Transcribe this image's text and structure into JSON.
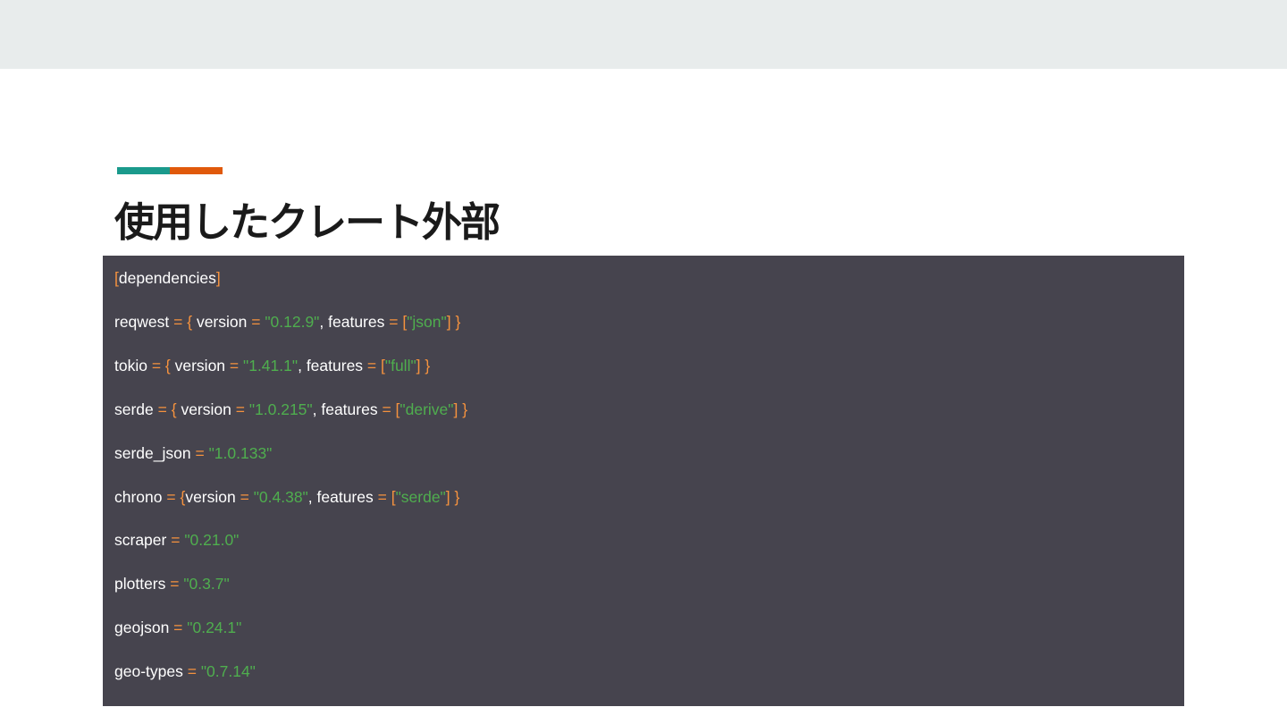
{
  "slide": {
    "title": "使用したクレート外部",
    "accent_colors": [
      "#1a9a8c",
      "#e0590b"
    ]
  },
  "code": {
    "colors": {
      "background": "#46444e",
      "key": "#ffffff",
      "punctuation": "#f5923e",
      "string": "#4fae4e"
    },
    "lines": [
      [
        {
          "t": "[",
          "k": "p"
        },
        {
          "t": "dependencies",
          "k": "k"
        },
        {
          "t": "]",
          "k": "p"
        }
      ],
      [
        {
          "t": "reqwest ",
          "k": "k"
        },
        {
          "t": "= { ",
          "k": "p"
        },
        {
          "t": "version ",
          "k": "k"
        },
        {
          "t": "= ",
          "k": "p"
        },
        {
          "t": "\"0.12.9\"",
          "k": "s"
        },
        {
          "t": ", features ",
          "k": "k"
        },
        {
          "t": "= [",
          "k": "p"
        },
        {
          "t": "\"json\"",
          "k": "s"
        },
        {
          "t": "] }",
          "k": "p"
        }
      ],
      [
        {
          "t": "tokio ",
          "k": "k"
        },
        {
          "t": "= { ",
          "k": "p"
        },
        {
          "t": "version ",
          "k": "k"
        },
        {
          "t": "= ",
          "k": "p"
        },
        {
          "t": "\"1.41.1\"",
          "k": "s"
        },
        {
          "t": ", features ",
          "k": "k"
        },
        {
          "t": "= [",
          "k": "p"
        },
        {
          "t": "\"full\"",
          "k": "s"
        },
        {
          "t": "] }",
          "k": "p"
        }
      ],
      [
        {
          "t": "serde ",
          "k": "k"
        },
        {
          "t": "= { ",
          "k": "p"
        },
        {
          "t": "version ",
          "k": "k"
        },
        {
          "t": "= ",
          "k": "p"
        },
        {
          "t": "\"1.0.215\"",
          "k": "s"
        },
        {
          "t": ", features ",
          "k": "k"
        },
        {
          "t": "= [",
          "k": "p"
        },
        {
          "t": "\"derive\"",
          "k": "s"
        },
        {
          "t": "] }",
          "k": "p"
        }
      ],
      [
        {
          "t": "serde_json ",
          "k": "k"
        },
        {
          "t": "= ",
          "k": "p"
        },
        {
          "t": "\"1.0.133\"",
          "k": "s"
        }
      ],
      [
        {
          "t": "chrono ",
          "k": "k"
        },
        {
          "t": "= {",
          "k": "p"
        },
        {
          "t": "version ",
          "k": "k"
        },
        {
          "t": "= ",
          "k": "p"
        },
        {
          "t": "\"0.4.38\"",
          "k": "s"
        },
        {
          "t": ", features ",
          "k": "k"
        },
        {
          "t": "= [",
          "k": "p"
        },
        {
          "t": "\"serde\"",
          "k": "s"
        },
        {
          "t": "] }",
          "k": "p"
        }
      ],
      [
        {
          "t": "scraper ",
          "k": "k"
        },
        {
          "t": "= ",
          "k": "p"
        },
        {
          "t": "\"0.21.0\"",
          "k": "s"
        }
      ],
      [
        {
          "t": "plotters ",
          "k": "k"
        },
        {
          "t": "= ",
          "k": "p"
        },
        {
          "t": "\"0.3.7\"",
          "k": "s"
        }
      ],
      [
        {
          "t": "geojson ",
          "k": "k"
        },
        {
          "t": "= ",
          "k": "p"
        },
        {
          "t": "\"0.24.1\"",
          "k": "s"
        }
      ],
      [
        {
          "t": "geo-types ",
          "k": "k"
        },
        {
          "t": "= ",
          "k": "p"
        },
        {
          "t": "\"0.7.14\"",
          "k": "s"
        }
      ]
    ]
  }
}
